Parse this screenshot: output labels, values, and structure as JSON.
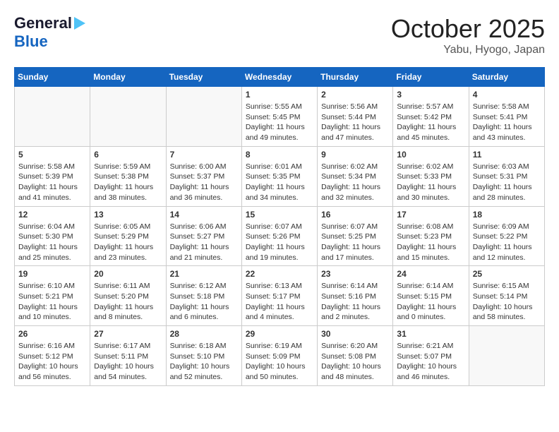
{
  "header": {
    "logo_general": "General",
    "logo_blue": "Blue",
    "month": "October 2025",
    "location": "Yabu, Hyogo, Japan"
  },
  "weekdays": [
    "Sunday",
    "Monday",
    "Tuesday",
    "Wednesday",
    "Thursday",
    "Friday",
    "Saturday"
  ],
  "weeks": [
    [
      {
        "day": "",
        "info": ""
      },
      {
        "day": "",
        "info": ""
      },
      {
        "day": "",
        "info": ""
      },
      {
        "day": "1",
        "info": "Sunrise: 5:55 AM\nSunset: 5:45 PM\nDaylight: 11 hours\nand 49 minutes."
      },
      {
        "day": "2",
        "info": "Sunrise: 5:56 AM\nSunset: 5:44 PM\nDaylight: 11 hours\nand 47 minutes."
      },
      {
        "day": "3",
        "info": "Sunrise: 5:57 AM\nSunset: 5:42 PM\nDaylight: 11 hours\nand 45 minutes."
      },
      {
        "day": "4",
        "info": "Sunrise: 5:58 AM\nSunset: 5:41 PM\nDaylight: 11 hours\nand 43 minutes."
      }
    ],
    [
      {
        "day": "5",
        "info": "Sunrise: 5:58 AM\nSunset: 5:39 PM\nDaylight: 11 hours\nand 41 minutes."
      },
      {
        "day": "6",
        "info": "Sunrise: 5:59 AM\nSunset: 5:38 PM\nDaylight: 11 hours\nand 38 minutes."
      },
      {
        "day": "7",
        "info": "Sunrise: 6:00 AM\nSunset: 5:37 PM\nDaylight: 11 hours\nand 36 minutes."
      },
      {
        "day": "8",
        "info": "Sunrise: 6:01 AM\nSunset: 5:35 PM\nDaylight: 11 hours\nand 34 minutes."
      },
      {
        "day": "9",
        "info": "Sunrise: 6:02 AM\nSunset: 5:34 PM\nDaylight: 11 hours\nand 32 minutes."
      },
      {
        "day": "10",
        "info": "Sunrise: 6:02 AM\nSunset: 5:33 PM\nDaylight: 11 hours\nand 30 minutes."
      },
      {
        "day": "11",
        "info": "Sunrise: 6:03 AM\nSunset: 5:31 PM\nDaylight: 11 hours\nand 28 minutes."
      }
    ],
    [
      {
        "day": "12",
        "info": "Sunrise: 6:04 AM\nSunset: 5:30 PM\nDaylight: 11 hours\nand 25 minutes."
      },
      {
        "day": "13",
        "info": "Sunrise: 6:05 AM\nSunset: 5:29 PM\nDaylight: 11 hours\nand 23 minutes."
      },
      {
        "day": "14",
        "info": "Sunrise: 6:06 AM\nSunset: 5:27 PM\nDaylight: 11 hours\nand 21 minutes."
      },
      {
        "day": "15",
        "info": "Sunrise: 6:07 AM\nSunset: 5:26 PM\nDaylight: 11 hours\nand 19 minutes."
      },
      {
        "day": "16",
        "info": "Sunrise: 6:07 AM\nSunset: 5:25 PM\nDaylight: 11 hours\nand 17 minutes."
      },
      {
        "day": "17",
        "info": "Sunrise: 6:08 AM\nSunset: 5:23 PM\nDaylight: 11 hours\nand 15 minutes."
      },
      {
        "day": "18",
        "info": "Sunrise: 6:09 AM\nSunset: 5:22 PM\nDaylight: 11 hours\nand 12 minutes."
      }
    ],
    [
      {
        "day": "19",
        "info": "Sunrise: 6:10 AM\nSunset: 5:21 PM\nDaylight: 11 hours\nand 10 minutes."
      },
      {
        "day": "20",
        "info": "Sunrise: 6:11 AM\nSunset: 5:20 PM\nDaylight: 11 hours\nand 8 minutes."
      },
      {
        "day": "21",
        "info": "Sunrise: 6:12 AM\nSunset: 5:18 PM\nDaylight: 11 hours\nand 6 minutes."
      },
      {
        "day": "22",
        "info": "Sunrise: 6:13 AM\nSunset: 5:17 PM\nDaylight: 11 hours\nand 4 minutes."
      },
      {
        "day": "23",
        "info": "Sunrise: 6:14 AM\nSunset: 5:16 PM\nDaylight: 11 hours\nand 2 minutes."
      },
      {
        "day": "24",
        "info": "Sunrise: 6:14 AM\nSunset: 5:15 PM\nDaylight: 11 hours\nand 0 minutes."
      },
      {
        "day": "25",
        "info": "Sunrise: 6:15 AM\nSunset: 5:14 PM\nDaylight: 10 hours\nand 58 minutes."
      }
    ],
    [
      {
        "day": "26",
        "info": "Sunrise: 6:16 AM\nSunset: 5:12 PM\nDaylight: 10 hours\nand 56 minutes."
      },
      {
        "day": "27",
        "info": "Sunrise: 6:17 AM\nSunset: 5:11 PM\nDaylight: 10 hours\nand 54 minutes."
      },
      {
        "day": "28",
        "info": "Sunrise: 6:18 AM\nSunset: 5:10 PM\nDaylight: 10 hours\nand 52 minutes."
      },
      {
        "day": "29",
        "info": "Sunrise: 6:19 AM\nSunset: 5:09 PM\nDaylight: 10 hours\nand 50 minutes."
      },
      {
        "day": "30",
        "info": "Sunrise: 6:20 AM\nSunset: 5:08 PM\nDaylight: 10 hours\nand 48 minutes."
      },
      {
        "day": "31",
        "info": "Sunrise: 6:21 AM\nSunset: 5:07 PM\nDaylight: 10 hours\nand 46 minutes."
      },
      {
        "day": "",
        "info": ""
      }
    ]
  ]
}
